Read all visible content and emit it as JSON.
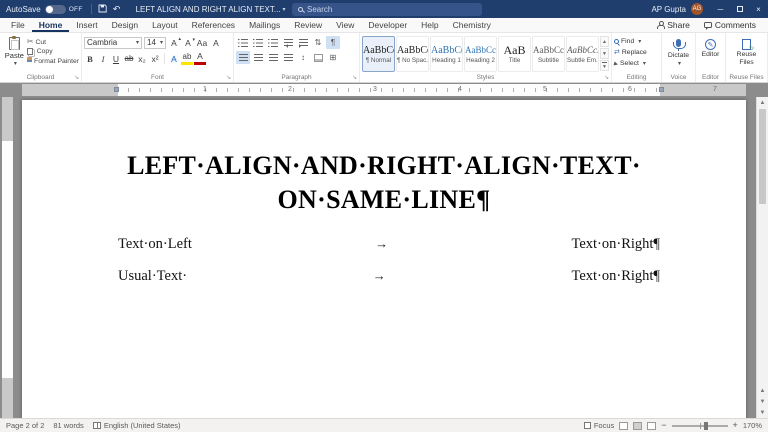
{
  "titlebar": {
    "autosave_label": "AutoSave",
    "autosave_state": "OFF",
    "doc_title": "LEFT ALIGN AND RIGHT ALIGN TEXT...",
    "search_placeholder": "Search",
    "user_name": "AP Gupta",
    "user_initials": "AG"
  },
  "tabs": {
    "items": [
      {
        "label": "File"
      },
      {
        "label": "Home"
      },
      {
        "label": "Insert"
      },
      {
        "label": "Design"
      },
      {
        "label": "Layout"
      },
      {
        "label": "References"
      },
      {
        "label": "Mailings"
      },
      {
        "label": "Review"
      },
      {
        "label": "View"
      },
      {
        "label": "Developer"
      },
      {
        "label": "Help"
      },
      {
        "label": "Chemistry"
      }
    ],
    "share_label": "Share",
    "comments_label": "Comments"
  },
  "ribbon": {
    "clipboard": {
      "group_label": "Clipboard",
      "paste_label": "Paste",
      "cut_label": "Cut",
      "copy_label": "Copy",
      "format_painter_label": "Format Painter"
    },
    "font": {
      "group_label": "Font",
      "font_name": "Cambria",
      "font_size": "14",
      "grow": "A",
      "shrink": "A",
      "case": "Aa",
      "clear": "A",
      "bold": "B",
      "italic": "I",
      "underline": "U",
      "strikethrough": "ab",
      "subscript": "x₂",
      "superscript": "x²",
      "effects": "A",
      "highlight": "ab",
      "color": "A"
    },
    "paragraph": {
      "group_label": "Paragraph",
      "pilcrow": "¶"
    },
    "styles": {
      "group_label": "Styles",
      "items": [
        {
          "preview": "AaBbCcD",
          "name": "¶ Normal"
        },
        {
          "preview": "AaBbCcD",
          "name": "¶ No Spac..."
        },
        {
          "preview": "AaBbC(",
          "name": "Heading 1"
        },
        {
          "preview": "AaBbCcE",
          "name": "Heading 2"
        },
        {
          "preview": "AaB",
          "name": "Title"
        },
        {
          "preview": "AaBbCcD",
          "name": "Subtitle"
        },
        {
          "preview": "AaBbCcD",
          "name": "Subtle Em..."
        }
      ]
    },
    "editing": {
      "group_label": "Editing",
      "find_label": "Find",
      "replace_label": "Replace",
      "select_label": "Select"
    },
    "voice": {
      "group_label": "Voice",
      "dictate_label": "Dictate"
    },
    "editor_group": {
      "group_label": "Editor",
      "editor_label": "Editor"
    },
    "reuse": {
      "group_label": "Reuse Files",
      "reuse_label": "Reuse Files"
    }
  },
  "ruler": {
    "numbers": [
      "1",
      "2",
      "3",
      "4",
      "5",
      "6",
      "7"
    ]
  },
  "document": {
    "heading_line1": "LEFT·ALIGN·AND·RIGHT·ALIGN·TEXT·",
    "heading_line2": "ON·SAME·LINE¶",
    "rows": [
      {
        "left": "Text·on·Left",
        "tab": "→",
        "right": "Text·on·Right¶"
      },
      {
        "left": "Usual·Text·",
        "tab": "→",
        "right": "Text·on·Right¶"
      }
    ]
  },
  "statusbar": {
    "page_info": "Page 2 of 2",
    "word_count": "81 words",
    "language": "English (United States)",
    "focus_label": "Focus",
    "zoom_level": "170%"
  },
  "colors": {
    "titlebar_bg": "#1f3d6d",
    "accent_blue": "#2b579a",
    "canvas_gray": "#8c8c8c"
  }
}
